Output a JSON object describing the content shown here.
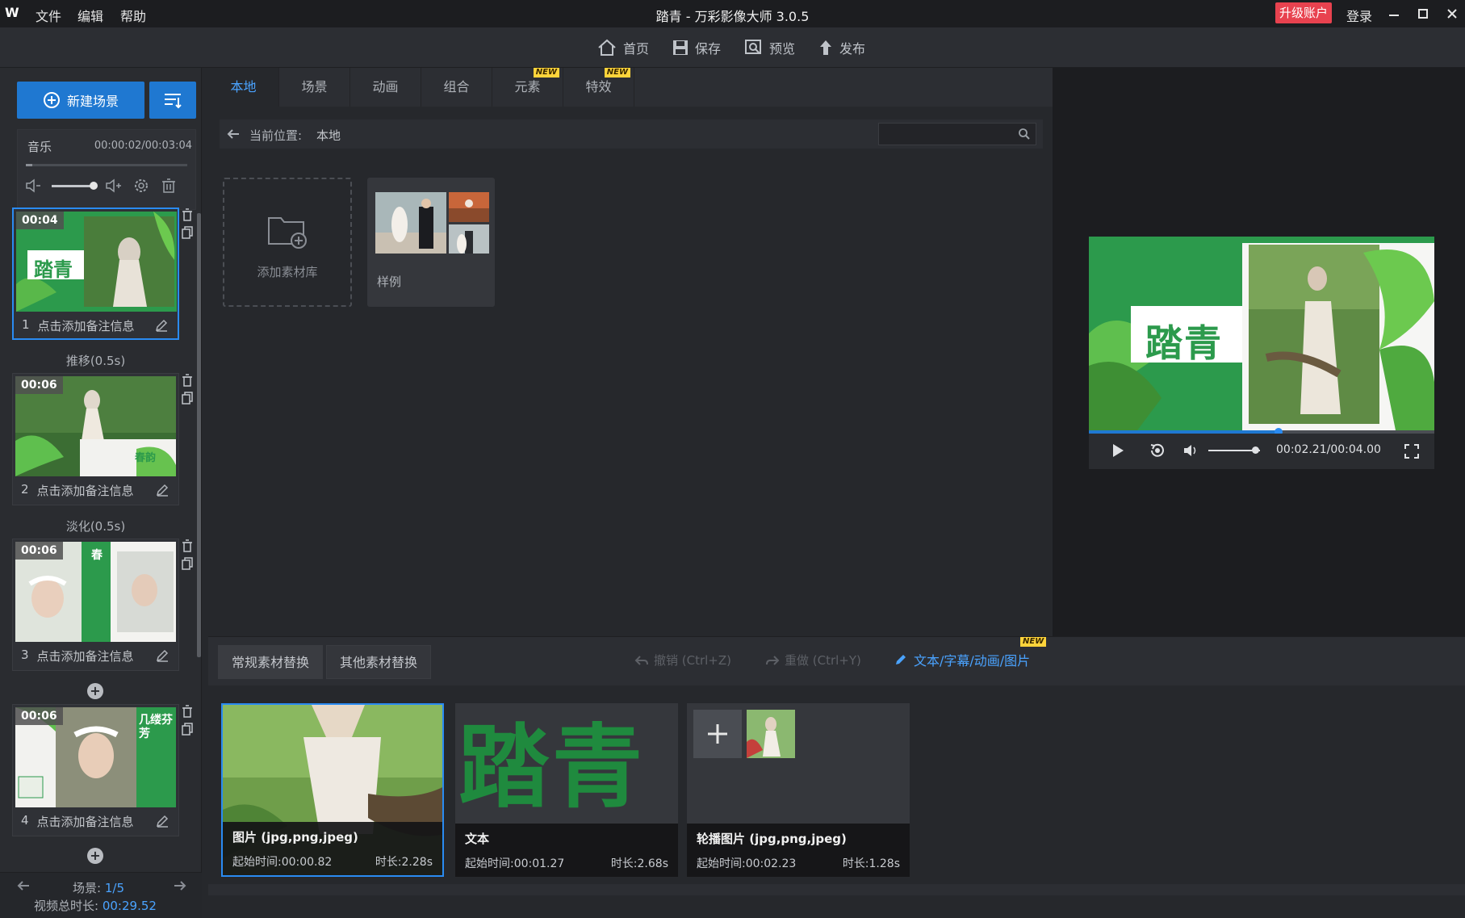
{
  "window": {
    "logo": "W",
    "title": "踏青 - 万彩影像大师 3.0.5",
    "menu": [
      "文件",
      "编辑",
      "帮助"
    ],
    "upgrade": "升级账户",
    "login": "登录"
  },
  "toolbar": {
    "home": "首页",
    "save": "保存",
    "preview": "预览",
    "publish": "发布"
  },
  "left": {
    "new_scene": "新建场景",
    "music": {
      "label": "音乐",
      "time": "00:00:02/00:03:04",
      "volume": 0.85
    },
    "scenes": [
      {
        "index": "1",
        "time": "00:04",
        "note": "点击添加备注信息",
        "title": "踏青"
      },
      {
        "index": "2",
        "time": "00:06",
        "note": "点击添加备注信息",
        "title": "春韵"
      },
      {
        "index": "3",
        "time": "00:06",
        "note": "点击添加备注信息",
        "title": "春"
      },
      {
        "index": "4",
        "time": "00:06",
        "note": "点击添加备注信息",
        "title": "几缕芬芳"
      }
    ],
    "transitions": [
      "推移(0.5s)",
      "淡化(0.5s)"
    ],
    "footer": {
      "scene_label": "场景:",
      "scene_value": "1/5",
      "total_label": "视频总时长:",
      "total_value": "00:29.52"
    }
  },
  "center": {
    "tabs": [
      {
        "label": "本地",
        "new": false
      },
      {
        "label": "场景",
        "new": false
      },
      {
        "label": "动画",
        "new": false
      },
      {
        "label": "组合",
        "new": false
      },
      {
        "label": "元素",
        "new": true
      },
      {
        "label": "特效",
        "new": true
      }
    ],
    "new_badge": "NEW",
    "location_label": "当前位置:",
    "location_value": "本地",
    "search_placeholder": "",
    "add_library": "添加素材库",
    "sample_folder": "样例"
  },
  "preview": {
    "title": "踏青",
    "time": "00:02.21/00:04.00",
    "progress": 0.55,
    "volume": 0.9
  },
  "bottom": {
    "tabs": [
      "常规素材替换",
      "其他素材替换"
    ],
    "undo": "撤销 (Ctrl+Z)",
    "redo": "重做 (Ctrl+Y)",
    "edit_link": "文本/字幕/动画/图片",
    "new_badge": "NEW",
    "assets": [
      {
        "name": "图片 (jpg,png,jpeg)",
        "start": "起始时间:00:00.82",
        "duration": "时长:2.28s"
      },
      {
        "name": "文本",
        "start": "起始时间:00:01.27",
        "duration": "时长:2.68s",
        "text": "踏青"
      },
      {
        "name": "轮播图片 (jpg,png,jpeg)",
        "start": "起始时间:00:02.23",
        "duration": "时长:1.28s"
      }
    ]
  },
  "colors": {
    "accent": "#1f78d1",
    "green": "#2c9a4c",
    "upgrade": "#e8424f"
  }
}
